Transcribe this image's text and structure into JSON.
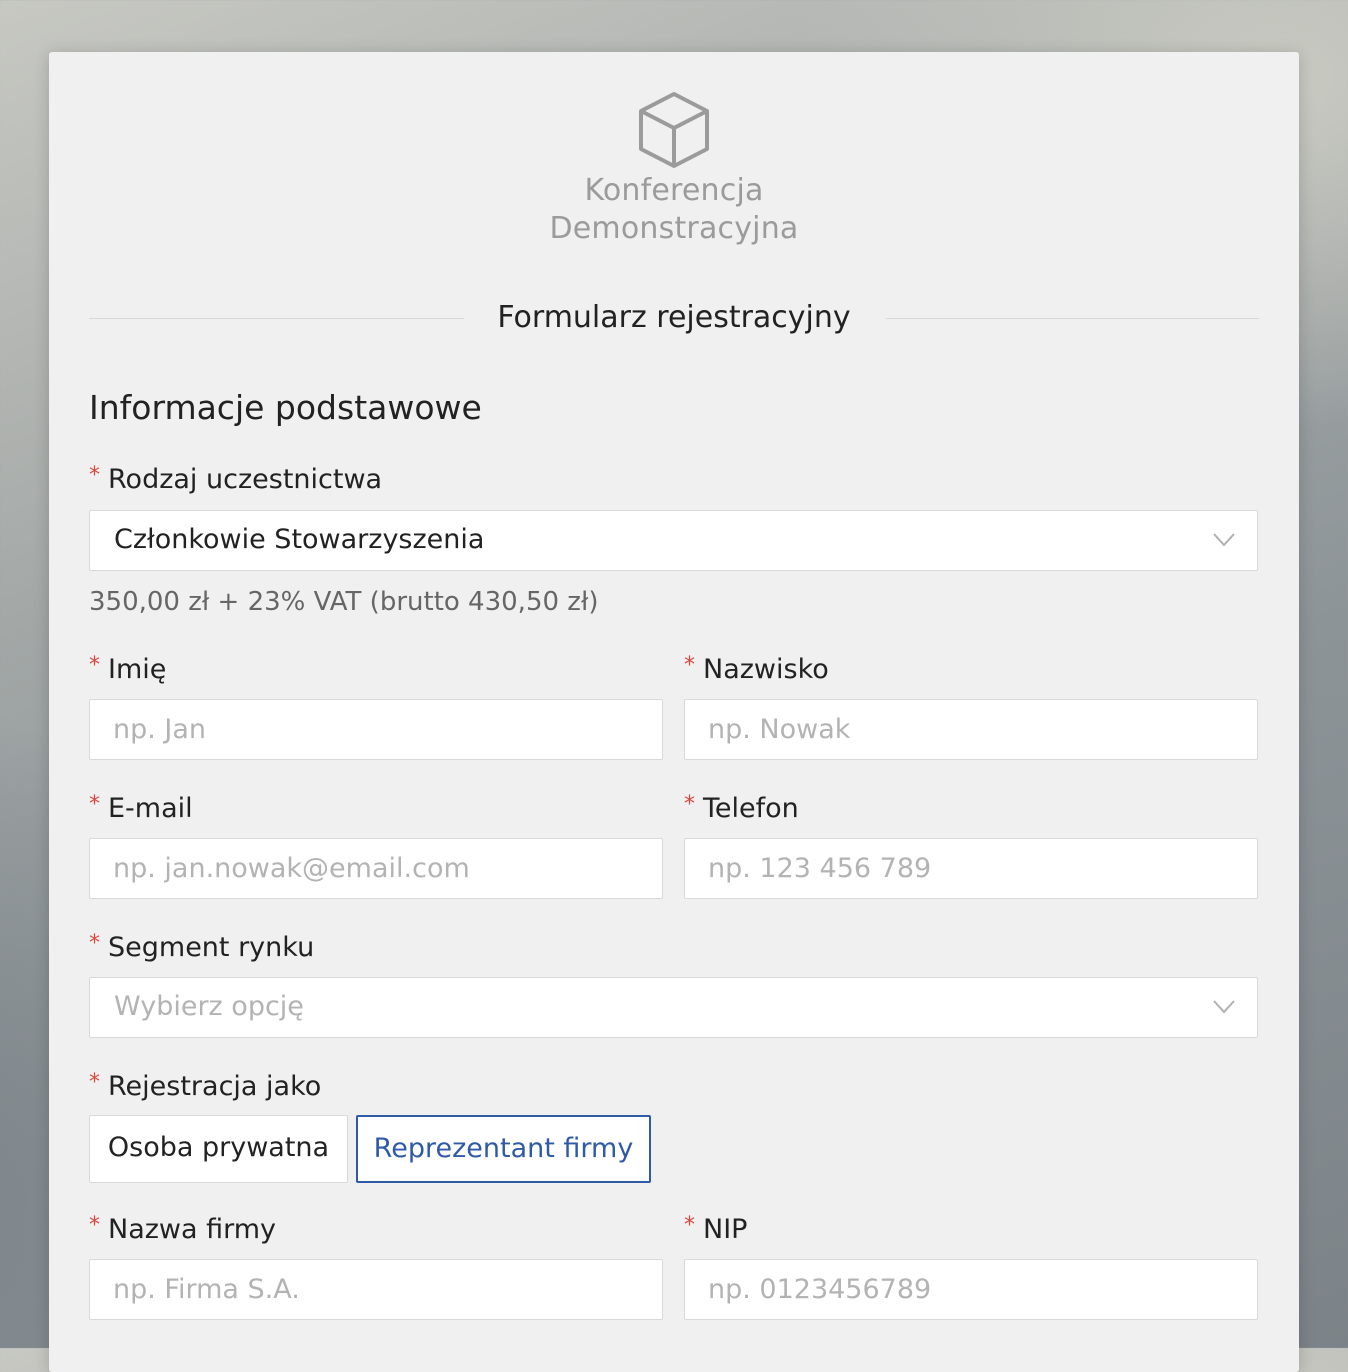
{
  "brand": {
    "logo_icon": "cube-icon",
    "line1": "Konferencja",
    "line2": "Demonstracyjna"
  },
  "form_title": "Formularz rejestracyjny",
  "section_title": "Informacje podstawowe",
  "required_mark": "*",
  "participation": {
    "label": "Rodzaj uczestnictwa",
    "value": "Członkowie Stowarzyszenia",
    "price": "350,00 zł + 23% VAT (brutto 430,50 zł)"
  },
  "first_name": {
    "label": "Imię",
    "placeholder": "np. Jan"
  },
  "last_name": {
    "label": "Nazwisko",
    "placeholder": "np. Nowak"
  },
  "email": {
    "label": "E-mail",
    "placeholder": "np. jan.nowak@email.com"
  },
  "phone": {
    "label": "Telefon",
    "placeholder": "np. 123 456 789"
  },
  "segment": {
    "label": "Segment rynku",
    "placeholder": "Wybierz opcję"
  },
  "registration_as": {
    "label": "Rejestracja jako",
    "options": [
      "Osoba prywatna",
      "Reprezentant firmy"
    ],
    "selected": "Reprezentant firmy"
  },
  "company_name": {
    "label": "Nazwa firmy",
    "placeholder": "np. Firma S.A."
  },
  "nip": {
    "label": "NIP",
    "placeholder": "np. 0123456789"
  },
  "colors": {
    "accent": "#2f5aa8",
    "required": "#e0463f",
    "card_bg": "#f0f0f0",
    "logo": "#9b9b9b"
  }
}
